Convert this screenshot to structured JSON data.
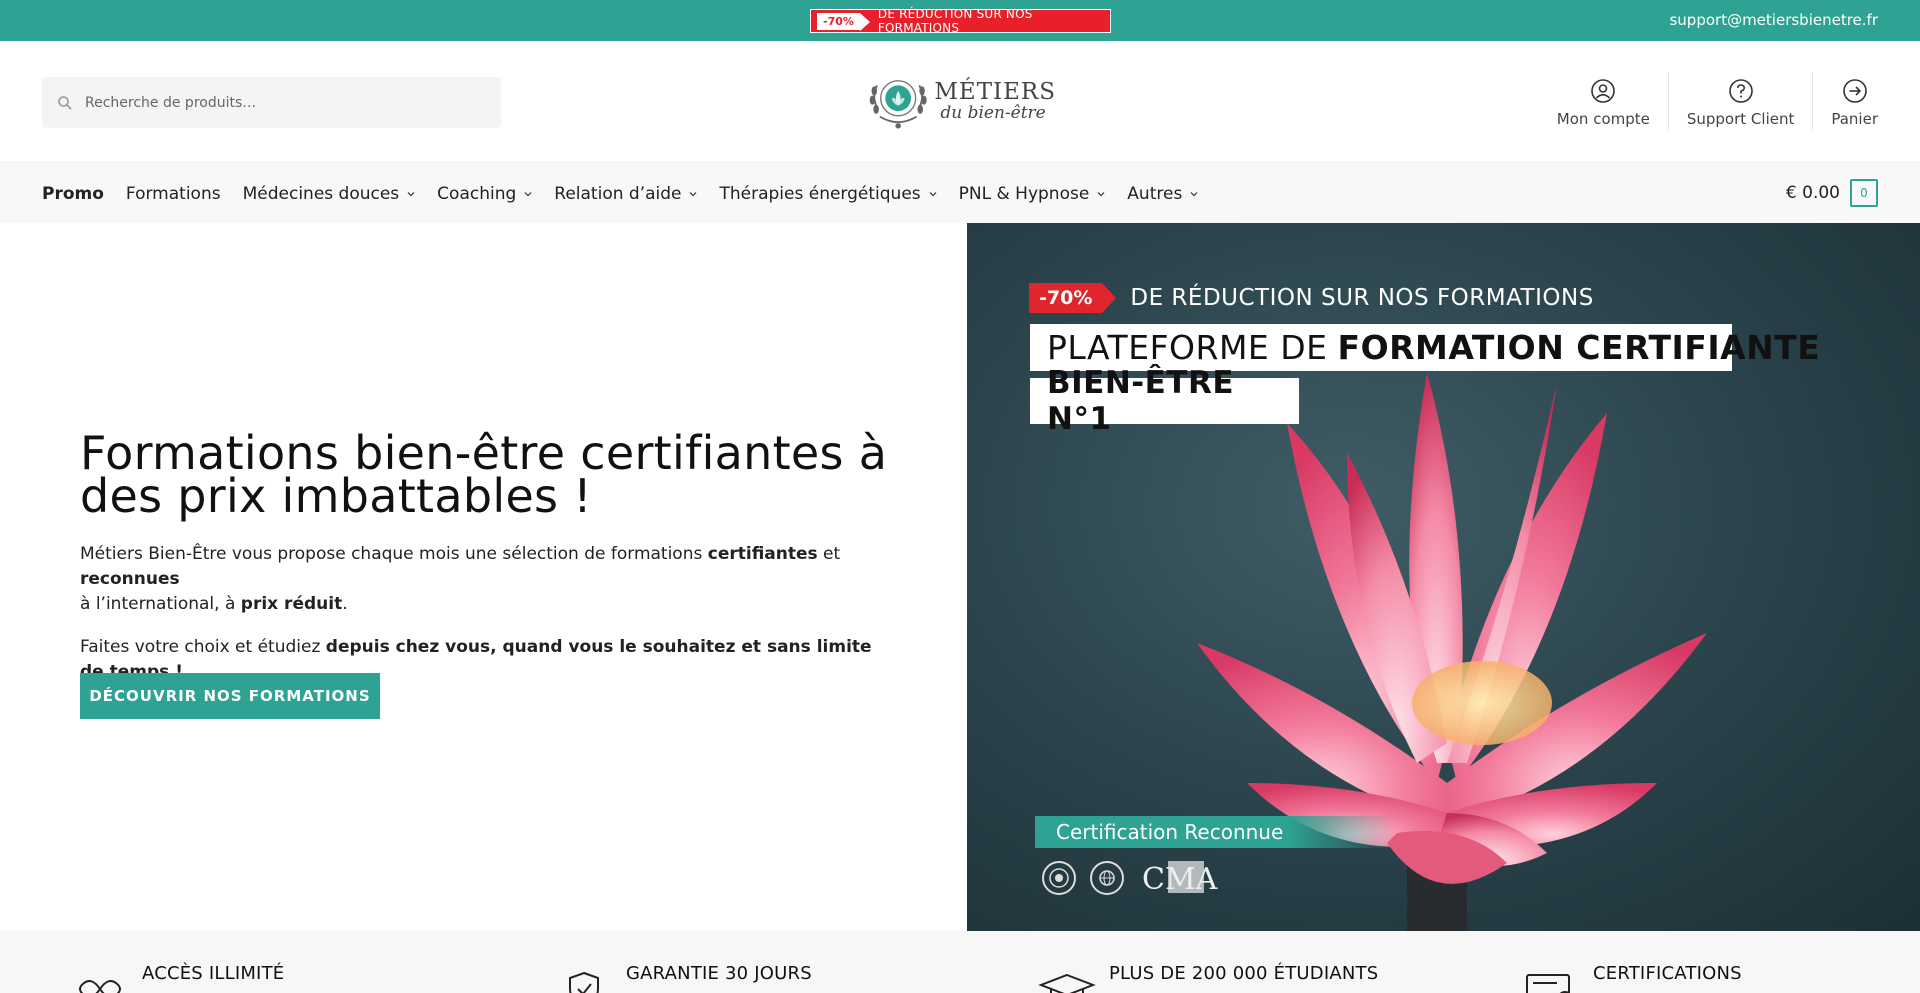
{
  "topbar": {
    "promo_pct": "-70%",
    "promo_text": "DE RÉDUCTION SUR NOS FORMATIONS",
    "support_email": "support@metiersbienetre.fr"
  },
  "header": {
    "search_placeholder": "Recherche de produits…",
    "logo_line1": "MÉTIERS",
    "logo_line2": "du bien-être",
    "actions": [
      {
        "label": "Mon compte",
        "icon": "user-icon"
      },
      {
        "label": "Support Client",
        "icon": "help-icon"
      },
      {
        "label": "Panier",
        "icon": "cart-arrow-icon"
      }
    ]
  },
  "nav": {
    "items": [
      {
        "label": "Promo",
        "dropdown": false
      },
      {
        "label": "Formations",
        "dropdown": false
      },
      {
        "label": "Médecines douces",
        "dropdown": true
      },
      {
        "label": "Coaching",
        "dropdown": true
      },
      {
        "label": "Relation d’aide",
        "dropdown": true
      },
      {
        "label": "Thérapies énergétiques",
        "dropdown": true
      },
      {
        "label": "PNL & Hypnose",
        "dropdown": true
      },
      {
        "label": "Autres",
        "dropdown": true
      }
    ],
    "cart_amount": "€ 0.00",
    "cart_count": "0"
  },
  "hero": {
    "title": "Formations bien-être certifiantes à des prix imbattables !",
    "p1_a": "Métiers Bien-Être vous propose chaque mois une sélection de formations ",
    "p1_b": "certifiantes",
    "p1_c": " et ",
    "p1_d": "reconnues",
    "p1_e": " à l’international, à ",
    "p1_f": "prix réduit",
    "p1_g": ".",
    "p2_a": "Faites votre choix et étudiez ",
    "p2_b": "depuis chez vous, quand vous le souhaitez et sans limite de temps !",
    "cta": "DÉCOUVRIR NOS FORMATIONS"
  },
  "hero_image": {
    "badge_pct": "-70%",
    "badge_text": "DE RÉDUCTION SUR NOS FORMATIONS",
    "line1_a": "PLATEFORME DE",
    "line1_b": "FORMATION CERTIFIANTE",
    "line2": "BIEN-ÊTRE N°1",
    "cert_label": "Certification Reconnue",
    "cma_text": "CMA"
  },
  "features": [
    {
      "label": "ACCÈS ILLIMITÉ",
      "icon": "infinity-icon"
    },
    {
      "label": "GARANTIE 30 JOURS",
      "icon": "shield-check-icon"
    },
    {
      "label": "PLUS DE 200 000 ÉTUDIANTS",
      "icon": "graduation-cap-icon"
    },
    {
      "label": "CERTIFICATIONS",
      "icon": "certificate-icon"
    }
  ],
  "colors": {
    "brand": "#2ea393",
    "promo_red": "#e8202c"
  }
}
